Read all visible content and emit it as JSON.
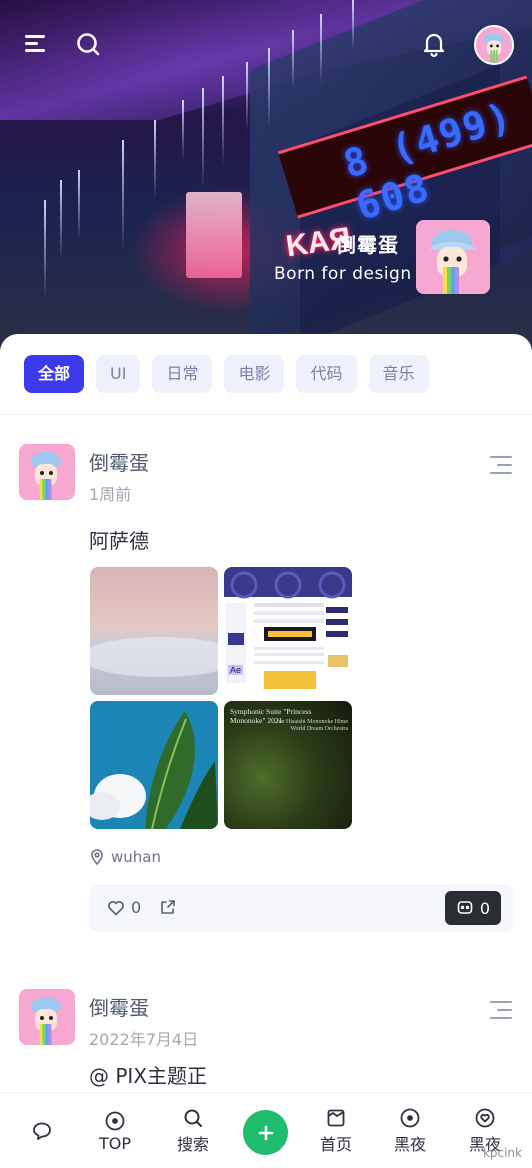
{
  "header": {
    "profile_name": "倒霉蛋",
    "tagline": "Born for design",
    "sign_text": "8 (499) 608",
    "neon_text": "KAЯ"
  },
  "tabs": [
    {
      "label": "全部",
      "active": true
    },
    {
      "label": "UI",
      "active": false
    },
    {
      "label": "日常",
      "active": false
    },
    {
      "label": "电影",
      "active": false
    },
    {
      "label": "代码",
      "active": false
    },
    {
      "label": "音乐",
      "active": false
    }
  ],
  "posts": [
    {
      "author": "倒霉蛋",
      "time": "1周前",
      "title": "阿萨德",
      "location": "wuhan",
      "likes": "0",
      "comments": "0",
      "image_captions": {
        "moss_title": "Symphonic Suite \"Princess Mononoke\" 2021",
        "moss_sub": "Joe Hisaishi Mononoke Hime World Dream Orchestra",
        "screen_badge": "Ae"
      }
    },
    {
      "author": "倒霉蛋",
      "time": "2022年7月4日",
      "title": "@ PIX主题正"
    }
  ],
  "bottom_nav": {
    "top": "TOP",
    "search": "搜索",
    "home": "首页",
    "night1": "黑夜",
    "night2": "黑夜"
  },
  "watermark": "kpcink",
  "colors": {
    "accent": "#3b39ea",
    "fab": "#1fbd6b",
    "tab_bg": "#eef0fb"
  }
}
